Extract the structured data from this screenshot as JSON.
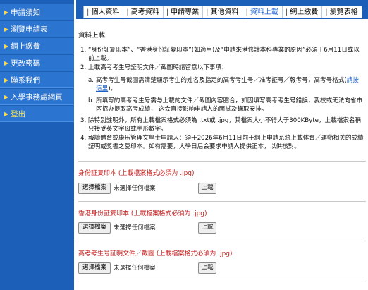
{
  "sidebar": {
    "items": [
      {
        "label": "申請須知"
      },
      {
        "label": "瀏覽申請表"
      },
      {
        "label": "網上繳費"
      },
      {
        "label": "更改密碼"
      },
      {
        "label": "聯系我們"
      },
      {
        "label": "入學事務處網頁"
      },
      {
        "label": "登出"
      }
    ]
  },
  "tabs": [
    {
      "label": "個人資料"
    },
    {
      "label": "高考資料"
    },
    {
      "label": "申請專業"
    },
    {
      "label": "其他資料"
    },
    {
      "label": "資料上載"
    },
    {
      "label": "網上繳費"
    },
    {
      "label": "瀏覽表格"
    }
  ],
  "active_tab": "資料上載",
  "section_title": "資料上載",
  "notes": [
    {
      "num": "1.",
      "text": "“身份証复印本”、“香港身份証复印本”(如適用)及“申請來港修讀本科專業的原因”必須于6月11日或以前上載。"
    },
    {
      "num": "2.",
      "text": "上載高考考生号証明文件／截圖時請留意以下事項："
    },
    {
      "num": "3.",
      "text": "除特別註明外，所有上載檔案格式必須為 .txt或 .jpg，其檔案大小不得大于300KByte，上載檔案名稱只接受英文字母或半形數字。"
    },
    {
      "num": "4.",
      "text": "報讀體育或康乐管理文學士申請人：須于2026年6月11日前于網上申請系統上載体育／運動相关的成績証明或獎書之复印本。如有需要，大學日后会要求申請人提供正本，以供核對。"
    }
  ],
  "subnotes": {
    "a": {
      "label": "a.",
      "text_before": "高考考生号截圖需清楚顯示考生的姓名及指定的高考考生号／准考証号／報考号，高考号格式(",
      "link": "請按這里",
      "text_after": ")。"
    },
    "b": {
      "label": "b.",
      "text": "所填写的高考考生号需与上載的文件／截圖內容脗合，如因填写高考考生号錯誤，我校或无法向省市区招办提取高考成績， 这会直接影响申請人的面試及錄取安排。"
    }
  },
  "uploads": [
    {
      "label": "身份証复印本 (上載檔案格式必須为 .jpg)",
      "file_button": "選擇檔案",
      "status": "未選擇任何檔案",
      "upload_button": "上載"
    },
    {
      "label": "香港身份証复印本 (上載檔案格式必須为 .jpg)",
      "file_button": "選擇檔案",
      "status": "未選擇任何檔案",
      "upload_button": "上載"
    },
    {
      "label": "高考考生号証明文件／截圖 (上載檔案格式必須为 .jpg)",
      "file_button": "選擇檔案",
      "status": "未選擇任何檔案",
      "upload_button": "上載"
    }
  ],
  "colors": {
    "sidebar_bg": "#1b5fb8",
    "sidebar_item": "#2b74cf",
    "bullet": "#ffd84a",
    "active_item_text": "#ffe75a",
    "upload_label": "#c62020",
    "link": "#2060c8"
  },
  "icons": {
    "sidebar_bullet": "triangle-bullet-icon"
  }
}
